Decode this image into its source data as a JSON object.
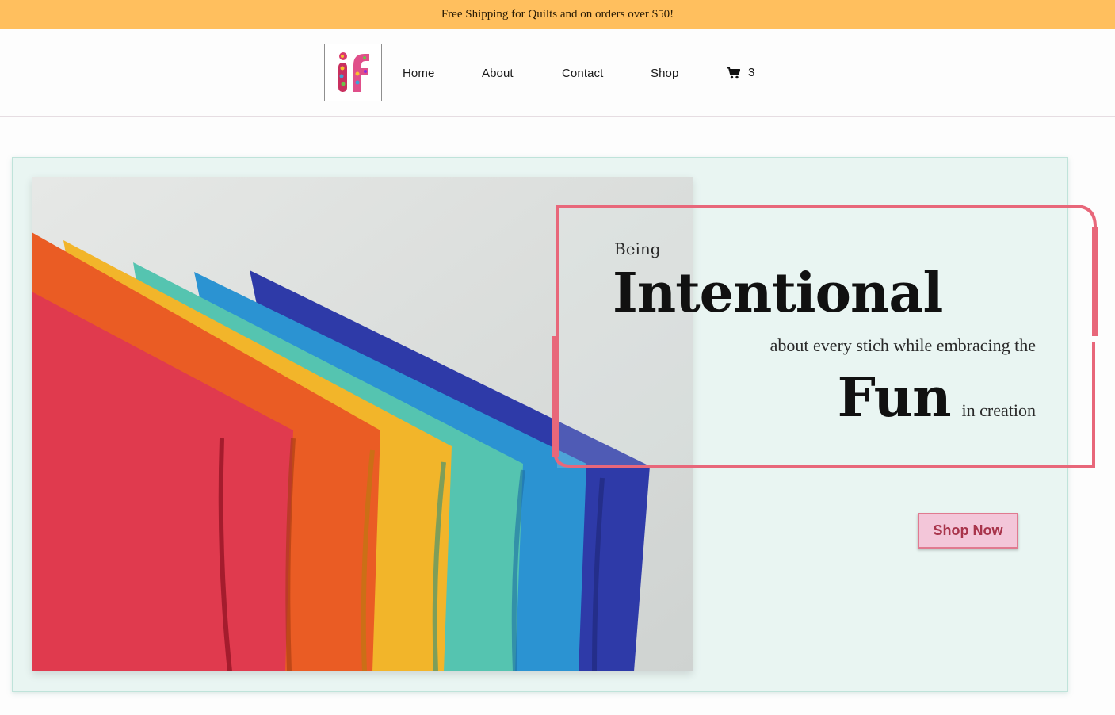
{
  "promo": {
    "text": "Free Shipping for Quilts and on orders over $50!"
  },
  "header": {
    "logo_text": "if",
    "nav": {
      "home": "Home",
      "about": "About",
      "contact": "Contact",
      "shop": "Shop"
    },
    "cart_count": "3"
  },
  "hero": {
    "being": "Being",
    "intentional": "Intentional",
    "about_line": "about every stich while embracing the",
    "fun": "Fun",
    "in_creation": "in creation",
    "cta": "Shop Now",
    "image_alt": "folded fabric",
    "fabric_colors": [
      "#e03a4e",
      "#ea5c24",
      "#f2b52a",
      "#55c4b0",
      "#2b93d2",
      "#2e3aa8"
    ]
  },
  "colors": {
    "promo_bg": "#ffbf5e",
    "hero_bg": "#e9f5f2",
    "accent_pink": "#e8677a",
    "button_bg": "#f3c6d9",
    "button_text": "#a8344b"
  },
  "icons": {
    "cart": "cart-icon"
  }
}
